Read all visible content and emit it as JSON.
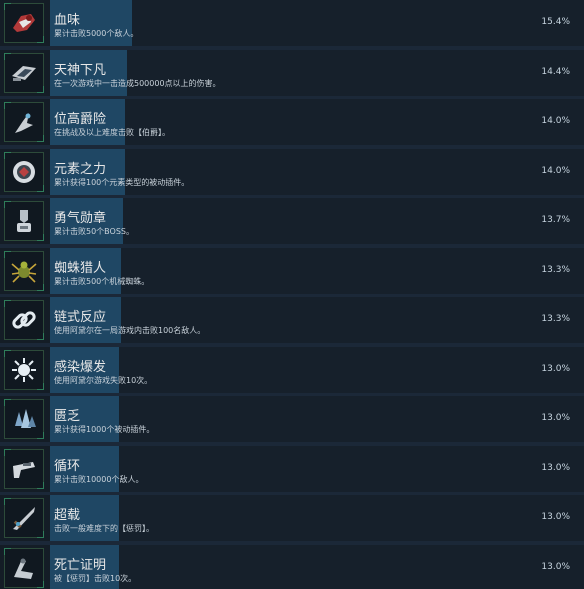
{
  "achievements": [
    {
      "icon": "blood-gear-icon",
      "title": "血味",
      "desc": "累计击败5000个敌人。",
      "pct": "15.4%",
      "rate": 15.4
    },
    {
      "icon": "heavenly-weapon-icon",
      "title": "天神下凡",
      "desc": "在一次游戏中一击造成500000点以上的伤害。",
      "pct": "14.4%",
      "rate": 14.4
    },
    {
      "icon": "claw-blade-icon",
      "title": "位高爵险",
      "desc": "在挑战及以上难度击败【伯爵】。",
      "pct": "14.0%",
      "rate": 14.0
    },
    {
      "icon": "element-orb-icon",
      "title": "元素之力",
      "desc": "累计获得100个元素类型的被动插件。",
      "pct": "14.0%",
      "rate": 14.0
    },
    {
      "icon": "medal-icon",
      "title": "勇气勋章",
      "desc": "累计击败50个BOSS。",
      "pct": "13.7%",
      "rate": 13.7
    },
    {
      "icon": "spider-icon",
      "title": "蜘蛛猎人",
      "desc": "累计击败500个机械蜘蛛。",
      "pct": "13.3%",
      "rate": 13.3
    },
    {
      "icon": "chain-link-icon",
      "title": "链式反应",
      "desc": "使用阿黛尔在一局游戏内击败100名敌人。",
      "pct": "13.3%",
      "rate": 13.3
    },
    {
      "icon": "virus-burst-icon",
      "title": "感染爆发",
      "desc": "使用阿黛尔游戏失败10次。",
      "pct": "13.0%",
      "rate": 13.0
    },
    {
      "icon": "crystal-cluster-icon",
      "title": "匮乏",
      "desc": "累计获得1000个被动插件。",
      "pct": "13.0%",
      "rate": 13.0
    },
    {
      "icon": "gun-icon",
      "title": "循环",
      "desc": "累计击败10000个敌人。",
      "pct": "13.0%",
      "rate": 13.0
    },
    {
      "icon": "sword-icon",
      "title": "超载",
      "desc": "击败一般难度下的【惩罚】。",
      "pct": "13.0%",
      "rate": 13.0
    },
    {
      "icon": "death-claw-icon",
      "title": "死亡证明",
      "desc": "被【惩罚】击败10次。",
      "pct": "13.0%",
      "rate": 13.0
    }
  ]
}
